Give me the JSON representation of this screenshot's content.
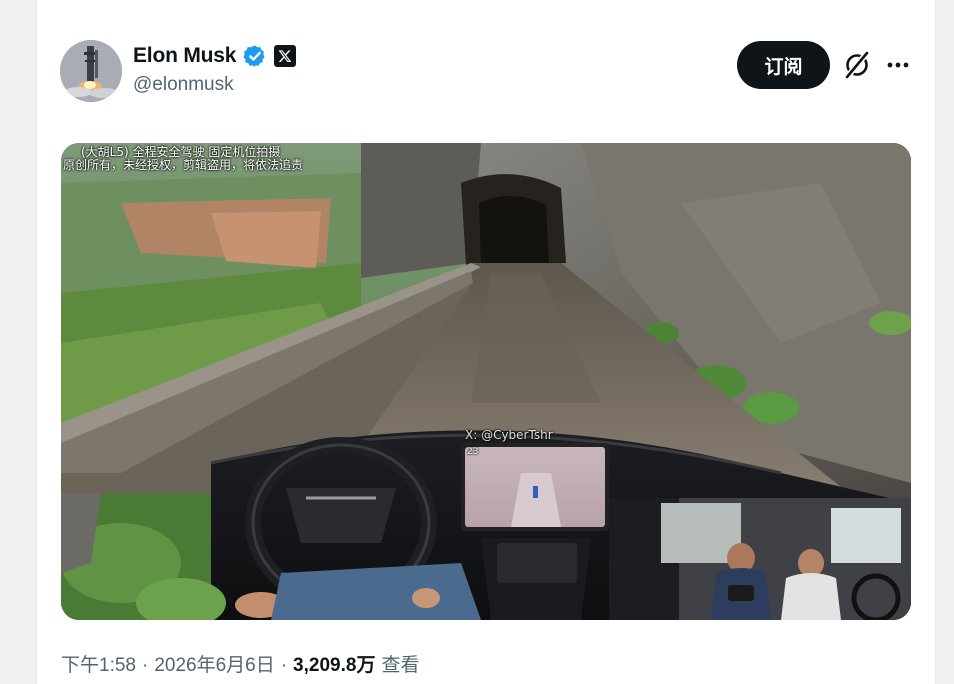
{
  "author": {
    "name": "Elon Musk",
    "handle": "@elonmusk",
    "verified": true,
    "affiliate_badge_icon": "x-logo-icon",
    "avatar_icon": "rocket-launch-avatar"
  },
  "actions": {
    "subscribe_label": "订阅",
    "grok_icon": "grok-icon",
    "more_icon": "more-horizontal-icon"
  },
  "media": {
    "overlay_line_1": "(大胡L5) 全程安全驾驶 固定机位拍摄",
    "overlay_line_2": "原创所有，未经授权，剪辑盗用，将依法追责",
    "watermark": "X: @CyberTshr",
    "screen_number": "23"
  },
  "meta": {
    "time": "下午1:58",
    "sep1": "·",
    "date": "2026年6月6日",
    "sep2": "·",
    "views": "3,209.8万",
    "views_label": "查看"
  },
  "colors": {
    "text_primary": "#0f1419",
    "text_secondary": "#536471",
    "verified_blue": "#1d9bf0",
    "button_bg": "#0f1419"
  }
}
